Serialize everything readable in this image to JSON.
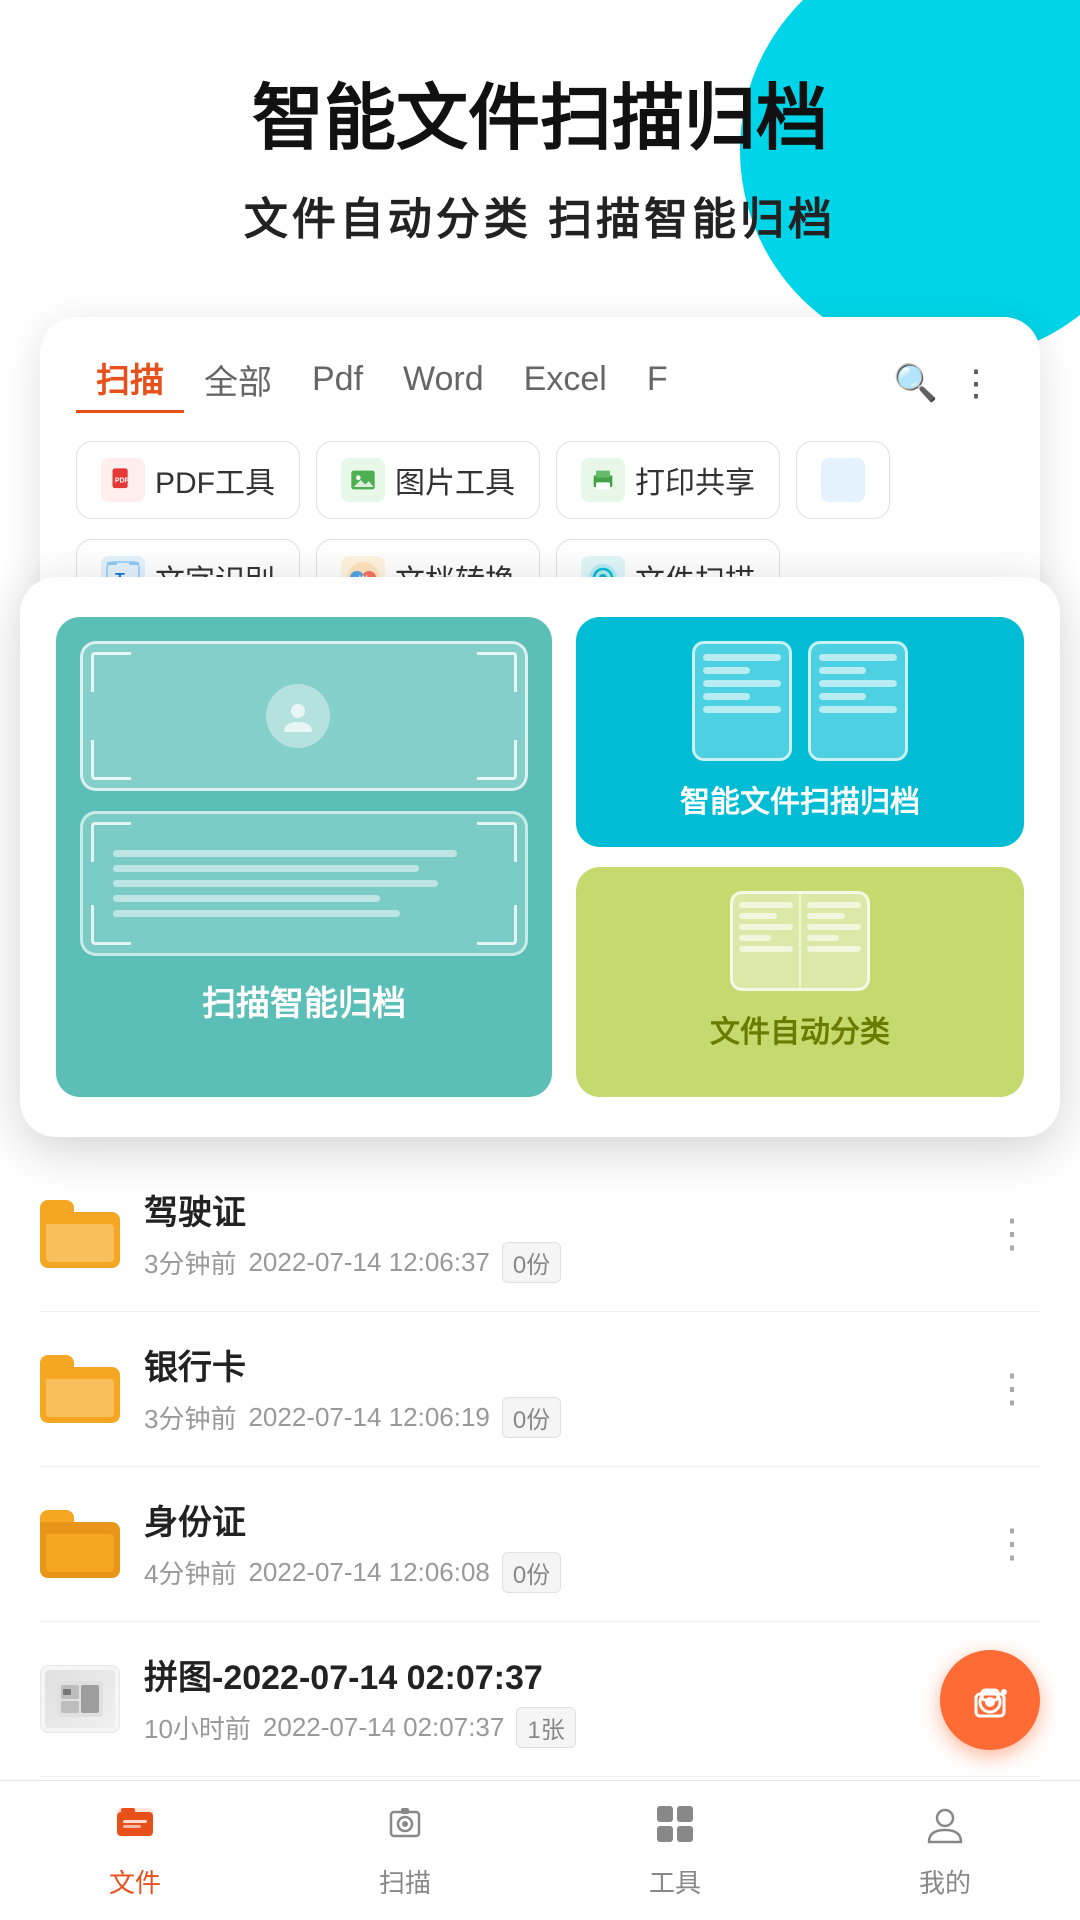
{
  "header": {
    "main_title": "智能文件扫描归档",
    "sub_title": "文件自动分类   扫描智能归档"
  },
  "tabs": {
    "items": [
      {
        "label": "扫描",
        "active": true
      },
      {
        "label": "全部",
        "active": false
      },
      {
        "label": "Pdf",
        "active": false
      },
      {
        "label": "Word",
        "active": false
      },
      {
        "label": "Excel",
        "active": false
      },
      {
        "label": "F",
        "active": false
      }
    ]
  },
  "tools": {
    "row1": [
      {
        "label": "PDF工具",
        "icon": "📄"
      },
      {
        "label": "图片工具",
        "icon": "🖼️"
      },
      {
        "label": "打印共享",
        "icon": "🖨️"
      }
    ],
    "row2": [
      {
        "label": "文字识别",
        "icon": "T"
      },
      {
        "label": "文档转换",
        "icon": "W"
      },
      {
        "label": "文件扫描",
        "icon": "📷"
      }
    ]
  },
  "features": {
    "scan_label": "扫描智能归档",
    "smart_label": "智能文件扫描归档",
    "category_label": "文件自动分类"
  },
  "file_list": {
    "items": [
      {
        "name": "驾驶证",
        "time_ago": "3分钟前",
        "date": "2022-07-14 12:06:37",
        "count": "0份",
        "type": "folder"
      },
      {
        "name": "银行卡",
        "time_ago": "3分钟前",
        "date": "2022-07-14 12:06:19",
        "count": "0份",
        "type": "folder"
      },
      {
        "name": "身份证",
        "time_ago": "4分钟前",
        "date": "2022-07-14 12:06:08",
        "count": "0份",
        "type": "folder"
      },
      {
        "name": "拼图-2022-07-14 02:07:37",
        "time_ago": "10小时前",
        "date": "2022-07-14 02:07:37",
        "count": "1张",
        "type": "image"
      }
    ]
  },
  "bottom_nav": {
    "items": [
      {
        "label": "文件",
        "active": true
      },
      {
        "label": "扫描",
        "active": false
      },
      {
        "label": "工具",
        "active": false
      },
      {
        "label": "我的",
        "active": false
      }
    ]
  }
}
